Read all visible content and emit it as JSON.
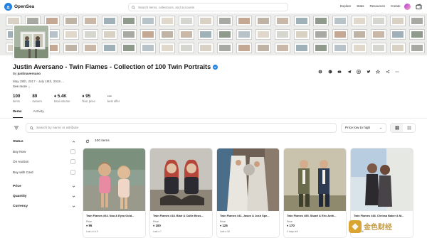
{
  "nav": {
    "brand": "OpenSea",
    "search_placeholder": "Search items, collections, and accounts",
    "links": [
      "Explore",
      "Stats",
      "Resources",
      "Create"
    ]
  },
  "collection": {
    "title": "Justin Aversano - Twin Flames - Collection of 100 Twin Portraits",
    "by_prefix": "By",
    "creator": "justinaversano",
    "dates": "May 28th, 2017 - July 18th, 2018 ...",
    "see_more": "See more",
    "stats": [
      {
        "value": "100",
        "label": "items"
      },
      {
        "value": "89",
        "label": "owners"
      },
      {
        "value": "♦ 5.4K",
        "label": "total volume"
      },
      {
        "value": "♦ 95",
        "label": "floor price"
      },
      {
        "value": "---",
        "label": "best offer"
      }
    ],
    "action_icons": [
      "globe-icon",
      "opensea-icon",
      "discord-icon",
      "telegram-icon",
      "instagram-icon",
      "twitter-icon",
      "star-icon",
      "share-icon",
      "more-icon"
    ]
  },
  "tabs": [
    "Items",
    "Activity"
  ],
  "filters": {
    "search_placeholder": "Search by name or attribute",
    "sort_value": "Price low to high",
    "status_label": "Status",
    "status_options": [
      "Buy Now",
      "On Auction",
      "Buy with Card"
    ],
    "sections": [
      "Price",
      "Quantity",
      "Currency"
    ]
  },
  "results_count": "100 items",
  "cards": [
    {
      "name": "Twin Flames #64. Noa & Eyva Gold...",
      "price_label": "Price",
      "price": "♦ 95",
      "last": "Last ♦ 14.9"
    },
    {
      "name": "Twin Flames #18. Blair & Callie Beus...",
      "price_label": "Price",
      "price": "♦ 100",
      "last": "Last ♦ 7"
    },
    {
      "name": "Twin Flames #41. Jason & Josh Spe...",
      "price_label": "Price",
      "price": "♦ 125",
      "last": "Last ♦ 18"
    },
    {
      "name": "Twin Flames #85. Stuart & Eric Anth...",
      "price_label": "Price",
      "price": "♦ 170",
      "last": "3 days left"
    },
    {
      "name": "Twin Flames #48. Chrissa Baker & M...",
      "price_label": "Price",
      "price": "♦ 275",
      "last": "Last ♦ 68"
    }
  ],
  "watermark": "金色财经",
  "colors": {
    "accent": "#2081e2",
    "text": "#1a1a1a",
    "muted": "#777777",
    "border": "#e5e5e5"
  }
}
